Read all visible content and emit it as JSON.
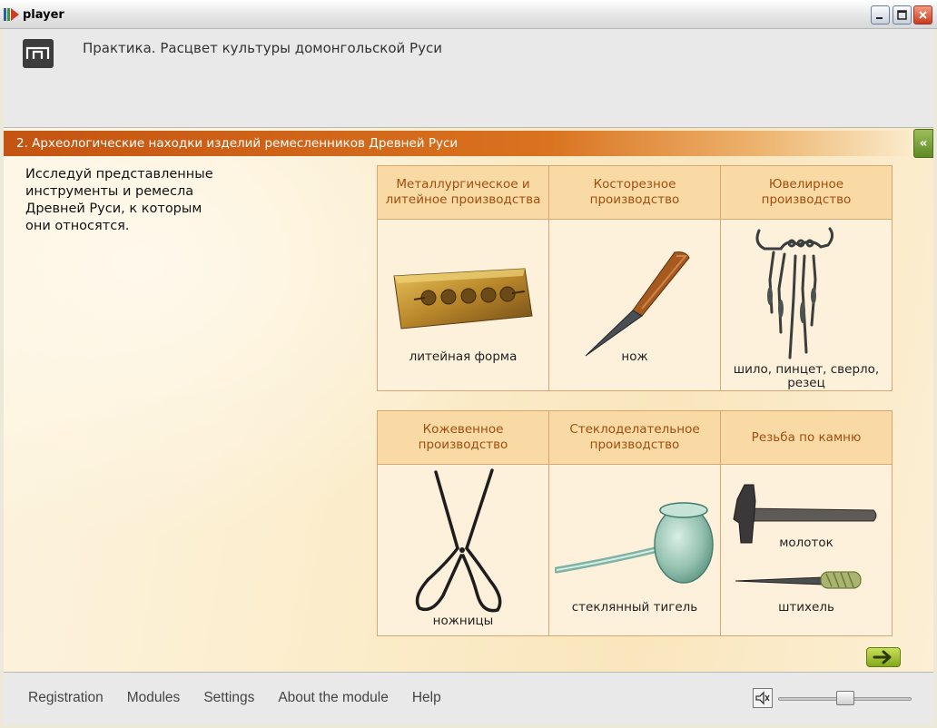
{
  "window": {
    "title": "player",
    "controls": [
      "minimize-icon",
      "maximize-icon",
      "close-icon"
    ]
  },
  "header": {
    "lesson_title": "Практика. Расцвет культуры домонгольской Руси",
    "logo_icon": "logo-icon"
  },
  "section": {
    "title": "2. Археологические находки изделий ремесленников Древней Руси",
    "collapse_label": "«",
    "instruction": "Исследуй представленные инструменты и ремесла Древней Руси, к которым они относятся."
  },
  "table_top": {
    "headers": [
      "Металлургическое и литейное производства",
      "Косторезное производство",
      "Ювелирное производство"
    ],
    "items": [
      {
        "label": "литейная форма",
        "icon": "casting-mold-icon"
      },
      {
        "label": "нож",
        "icon": "knife-icon"
      },
      {
        "label": "шило, пинцет, сверло, резец",
        "icon": "jewelry-tools-icon"
      }
    ]
  },
  "table_bottom": {
    "headers": [
      "Кожевенное производство",
      "Стеклоделательное производство",
      "Резьба по камню"
    ],
    "items": [
      {
        "label": "ножницы",
        "icon": "scissors-icon"
      },
      {
        "label": "стеклянный тигель",
        "icon": "glass-crucible-icon"
      },
      {
        "label": "молоток",
        "icon": "hammer-icon"
      },
      {
        "label": "штихель",
        "icon": "graver-icon"
      }
    ]
  },
  "next_button_icon": "arrow-right-icon",
  "footer": {
    "nav": [
      "Registration",
      "Modules",
      "Settings",
      "About the module",
      "Help"
    ],
    "volume_icon": "speaker-mute-icon",
    "volume_level": 0.5
  },
  "colors": {
    "section_bar": "#c45411",
    "header_cell": "#f9daa4",
    "header_text": "#a04e10",
    "next_button": "#9fc02f"
  }
}
